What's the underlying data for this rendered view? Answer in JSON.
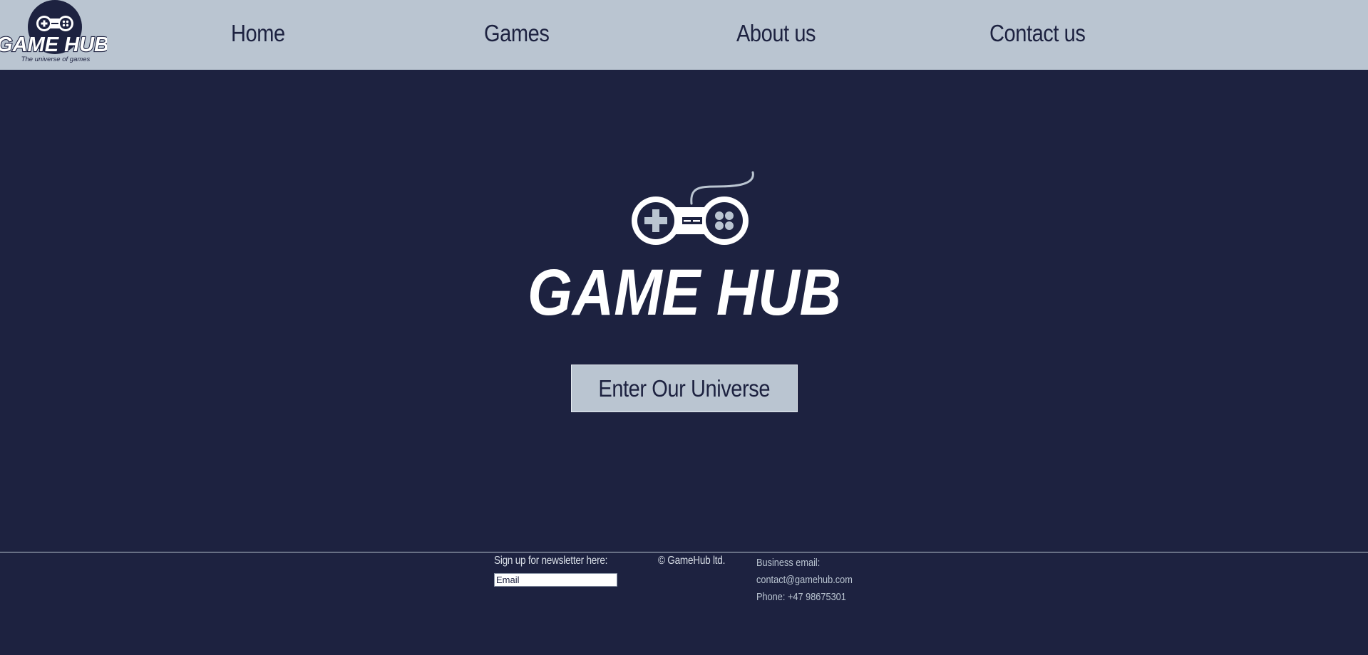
{
  "header": {
    "logo_title": "GAME HUB",
    "logo_tagline": "The universe of games",
    "nav": [
      "Home",
      "Games",
      "About us",
      "Contact us"
    ]
  },
  "hero": {
    "logo_title": "GAME HUB",
    "cta_label": "Enter Our Universe"
  },
  "footer": {
    "newsletter_label": "Sign up for newsletter here:",
    "email_placeholder": "Email",
    "copyright": "© GameHub ltd.",
    "business_email_label": "Business email:",
    "business_email": "contact@gamehub.com",
    "phone": "Phone: +47 98675301"
  },
  "colors": {
    "background": "#1d2240",
    "header": "#bac5d1",
    "text_dark": "#1d2240",
    "text_light": "#ffffff"
  },
  "icons": {
    "header_logo": "gamepad-icon",
    "hero_logo": "gamepad-icon"
  }
}
